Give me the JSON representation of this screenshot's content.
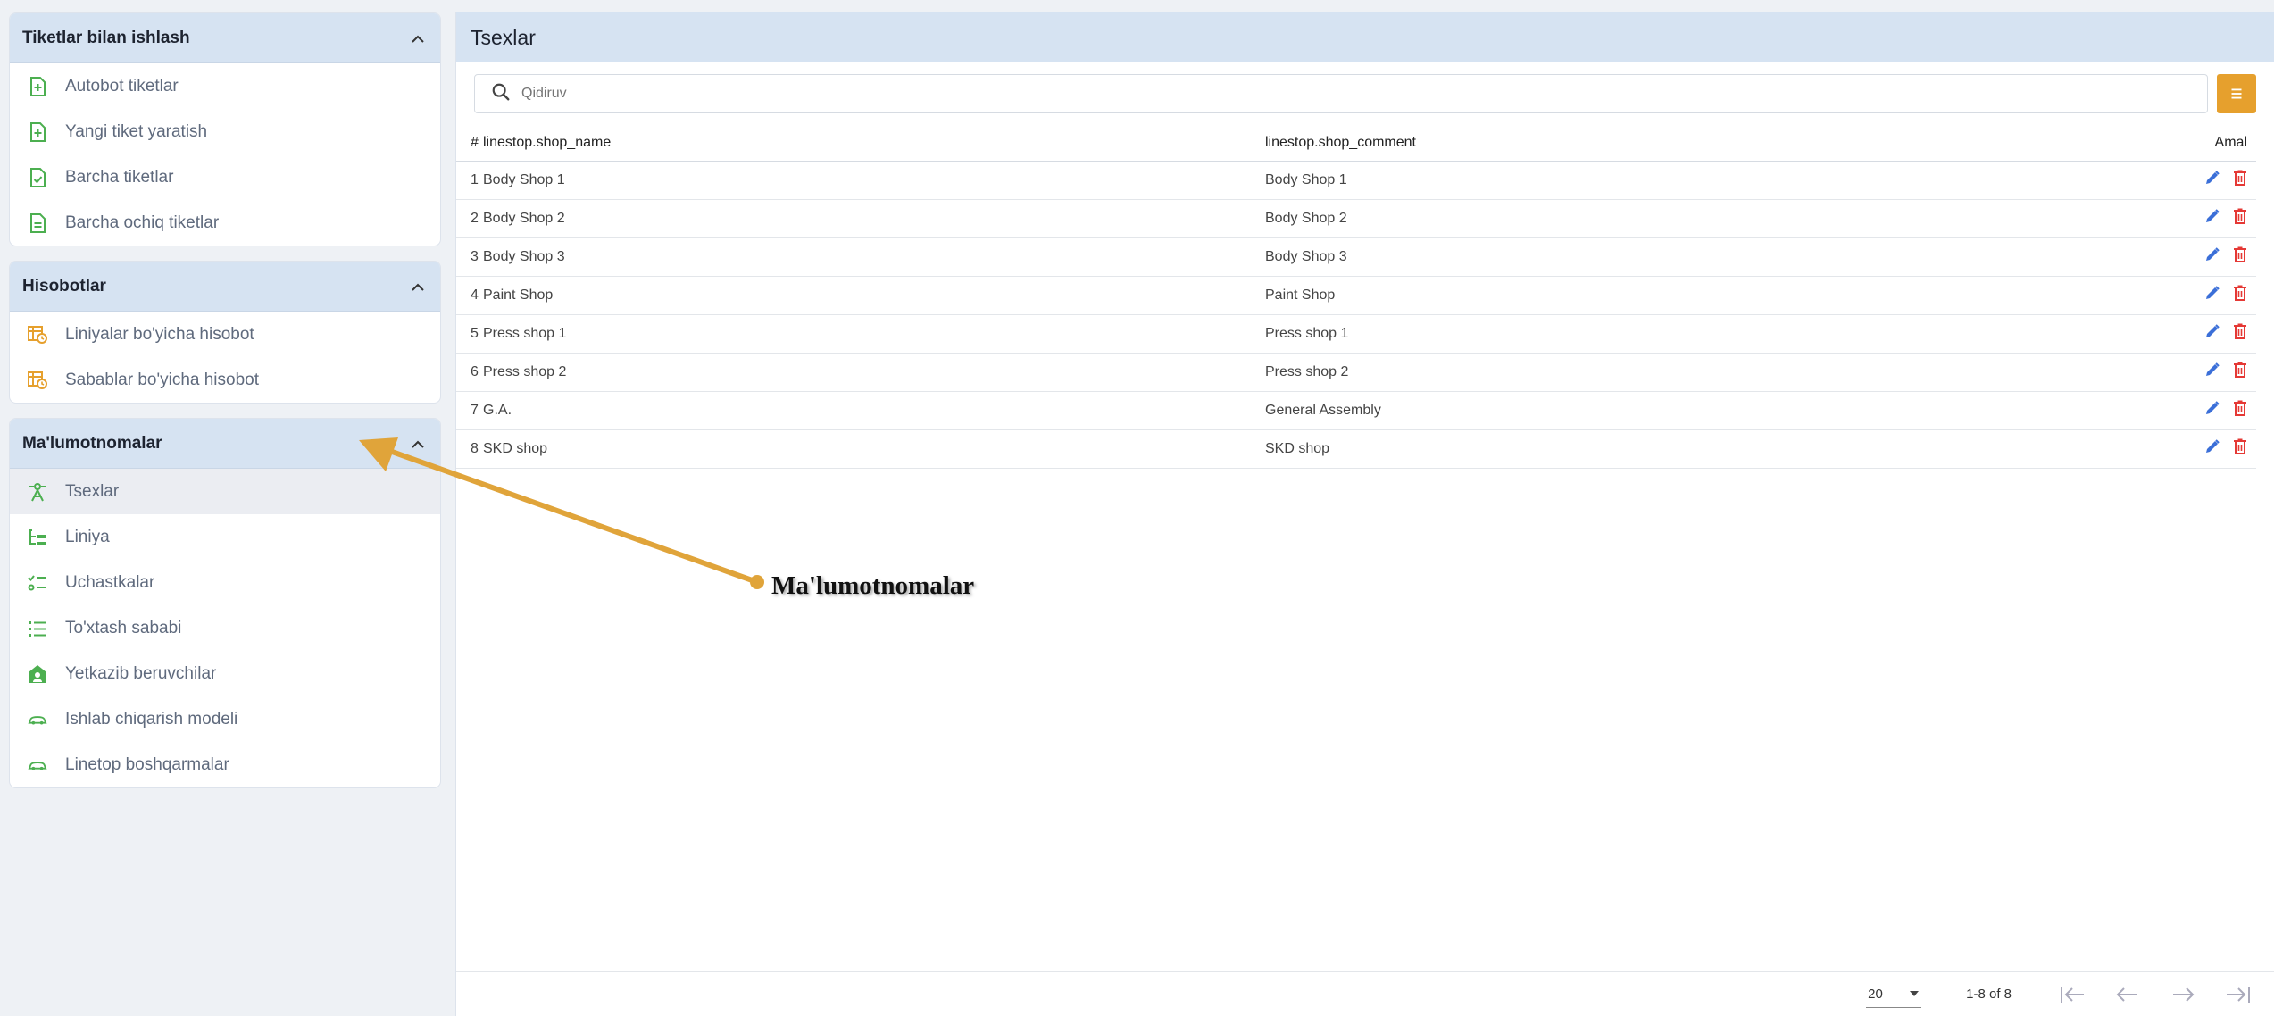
{
  "sidebar": {
    "groups": [
      {
        "title": "Tiketlar bilan ishlash",
        "items": [
          {
            "label": "Autobot tiketlar",
            "icon": "file-plus-icon"
          },
          {
            "label": "Yangi tiket yaratish",
            "icon": "file-plus-icon"
          },
          {
            "label": "Barcha tiketlar",
            "icon": "file-check-icon"
          },
          {
            "label": "Barcha ochiq tiketlar",
            "icon": "file-text-icon"
          }
        ]
      },
      {
        "title": "Hisobotlar",
        "items": [
          {
            "label": "Liniyalar bo'yicha hisobot",
            "icon": "report-table-icon"
          },
          {
            "label": "Sabablar bo'yicha hisobot",
            "icon": "report-table-icon"
          }
        ]
      },
      {
        "title": "Ma'lumotnomalar",
        "items": [
          {
            "label": "Tsexlar",
            "icon": "workshop-icon",
            "active": true
          },
          {
            "label": "Liniya",
            "icon": "hierarchy-icon"
          },
          {
            "label": "Uchastkalar",
            "icon": "list-check-icon"
          },
          {
            "label": "To'xtash sababi",
            "icon": "list-icon"
          },
          {
            "label": "Yetkazib beruvchilar",
            "icon": "supplier-icon"
          },
          {
            "label": "Ishlab chiqarish modeli",
            "icon": "car-icon"
          },
          {
            "label": "Linetop boshqarmalar",
            "icon": "car-icon"
          }
        ]
      }
    ]
  },
  "main": {
    "title": "Tsexlar",
    "search_placeholder": "Qidiruv",
    "columns": {
      "num": "#",
      "name": "linestop.shop_name",
      "comment": "linestop.shop_comment",
      "action": "Amal"
    },
    "rows": [
      {
        "num": "1",
        "name": "Body Shop 1",
        "comment": "Body Shop 1"
      },
      {
        "num": "2",
        "name": "Body Shop 2",
        "comment": "Body Shop 2"
      },
      {
        "num": "3",
        "name": "Body Shop 3",
        "comment": "Body Shop 3"
      },
      {
        "num": "4",
        "name": "Paint Shop",
        "comment": "Paint Shop"
      },
      {
        "num": "5",
        "name": "Press shop 1",
        "comment": "Press shop 1"
      },
      {
        "num": "6",
        "name": "Press shop 2",
        "comment": "Press shop 2"
      },
      {
        "num": "7",
        "name": "G.A.",
        "comment": "General Assembly"
      },
      {
        "num": "8",
        "name": "SKD shop",
        "comment": "SKD shop"
      }
    ],
    "footer": {
      "page_size": "20",
      "range": "1-8 of 8"
    }
  },
  "annotation": {
    "label": "Ma'lumotnomalar"
  },
  "colors": {
    "accent": "#e6a02d",
    "header_bg": "#d6e3f2",
    "edit": "#3b6fd8",
    "delete": "#e53935",
    "icon_green": "#4caf50",
    "icon_orange": "#e6a02d"
  }
}
